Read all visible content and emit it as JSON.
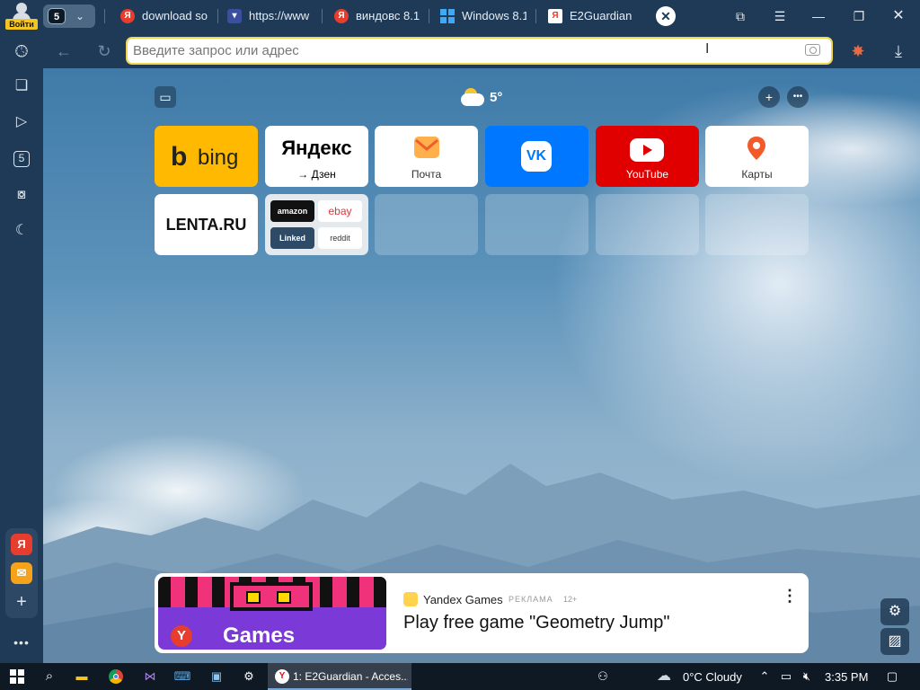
{
  "profile": {
    "login_label": "Войти"
  },
  "tab_group": {
    "count": "5"
  },
  "tabs": [
    {
      "label": "download so",
      "favicon": "yandex-icon"
    },
    {
      "label": "https://www",
      "favicon": "shield-icon"
    },
    {
      "label": "виндовс 8.1",
      "favicon": "yandex-icon"
    },
    {
      "label": "Windows 8.1",
      "favicon": "windows-icon"
    },
    {
      "label": "E2Guardian",
      "favicon": "yandex-doc-icon"
    }
  ],
  "omnibox": {
    "placeholder": "Введите запрос или адрес"
  },
  "sidebar": {
    "counter": "5"
  },
  "weather": {
    "temperature": "5°",
    "icon": "partly-cloudy-icon"
  },
  "tiles": [
    {
      "name": "bing",
      "label": "bing"
    },
    {
      "name": "yandex",
      "label": "Яндекс",
      "caption": "→ Дзен"
    },
    {
      "name": "pochta",
      "caption": "Почта"
    },
    {
      "name": "vk"
    },
    {
      "name": "youtube",
      "caption": "YouTube"
    },
    {
      "name": "karty",
      "caption": "Карты"
    },
    {
      "name": "lenta",
      "label": "LENTA.RU"
    },
    {
      "name": "folder",
      "items": [
        "amazon",
        "ebay",
        "Linked",
        "reddit"
      ]
    }
  ],
  "ad": {
    "source": "Yandex Games",
    "tag": "РЕКЛАМА",
    "age": "12+",
    "title": "Play free game \"Geometry Jump\"",
    "image_caption": "Games"
  },
  "taskbar": {
    "active_window": "1: E2Guardian - Acces...",
    "weather": "0°C  Cloudy",
    "time": "3:35 PM"
  },
  "colors": {
    "chrome": "#1e3a56",
    "omnibox_border": "#f0d64a",
    "bing": "#ffb900",
    "vk": "#0077ff",
    "youtube": "#e00000",
    "taskbar": "#0f1924"
  }
}
